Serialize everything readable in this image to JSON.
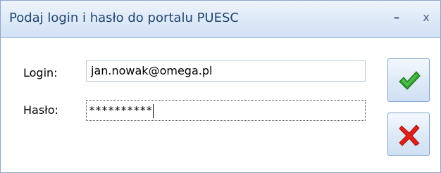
{
  "window": {
    "title": "Podaj login i hasło do portalu PUESC",
    "minimize_glyph": "–",
    "close_glyph": "x"
  },
  "form": {
    "login_label": "Login:",
    "login_value": "jan.nowak@omega.pl",
    "password_label": "Hasło:",
    "password_masked": "**********"
  },
  "buttons": {
    "ok_icon": "green-checkmark-icon",
    "cancel_icon": "red-x-icon"
  },
  "colors": {
    "titlebar": "#dde9f7",
    "title_text": "#20446f",
    "ok_green": "#2ea02e",
    "cancel_red": "#e0201a"
  }
}
